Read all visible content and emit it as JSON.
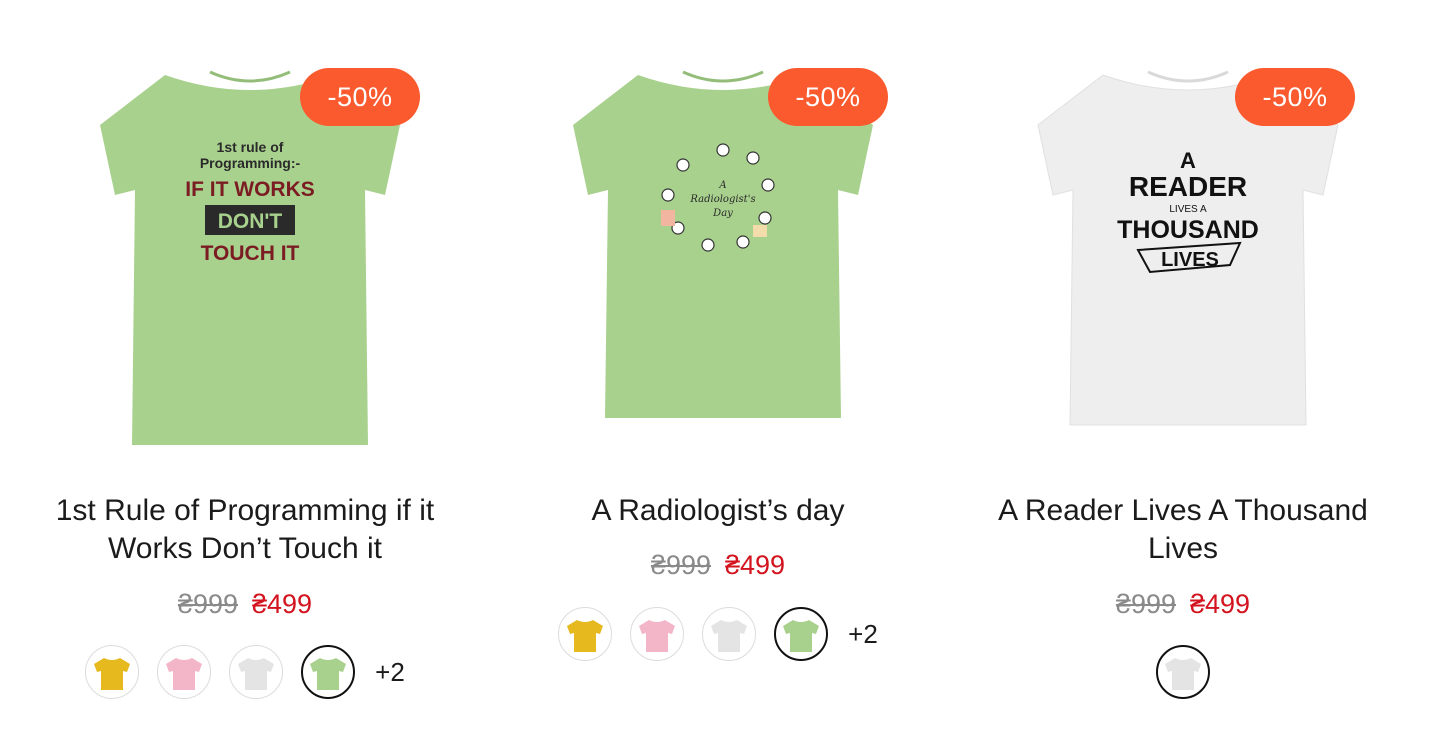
{
  "products": [
    {
      "title": "1st Rule of Programming if it Works Don’t Touch it",
      "badge": "-50%",
      "old_price": "₴999",
      "new_price": "₴499",
      "shirt_color": "#a9d18e",
      "print_lines": [
        "1st rule of",
        "Programming:-",
        "IF IT WORKS",
        "DON'T",
        "TOUCH IT"
      ],
      "swatches": [
        {
          "name": "yellow",
          "color": "#e6b91e",
          "selected": false
        },
        {
          "name": "pink",
          "color": "#f2b6c8",
          "selected": false
        },
        {
          "name": "white",
          "color": "#e4e4e4",
          "selected": false
        },
        {
          "name": "green",
          "color": "#a9d18e",
          "selected": true
        }
      ],
      "more": "+2"
    },
    {
      "title": "A Radiologist’s day",
      "badge": "-50%",
      "old_price": "₴999",
      "new_price": "₴499",
      "shirt_color": "#a9d18e",
      "print_lines": [
        "A",
        "Radiologist's",
        "Day"
      ],
      "swatches": [
        {
          "name": "yellow",
          "color": "#e6b91e",
          "selected": false
        },
        {
          "name": "pink",
          "color": "#f2b6c8",
          "selected": false
        },
        {
          "name": "white",
          "color": "#e4e4e4",
          "selected": false
        },
        {
          "name": "green",
          "color": "#a9d18e",
          "selected": true
        }
      ],
      "more": "+2"
    },
    {
      "title": "A Reader Lives A Thousand Lives",
      "badge": "-50%",
      "old_price": "₴999",
      "new_price": "₴499",
      "shirt_color": "#eeeeee",
      "print_lines": [
        "A",
        "READER",
        "LIVES A",
        "THOUSAND",
        "LIVES"
      ],
      "swatches": [
        {
          "name": "white",
          "color": "#e4e4e4",
          "selected": true
        }
      ],
      "more": ""
    }
  ]
}
